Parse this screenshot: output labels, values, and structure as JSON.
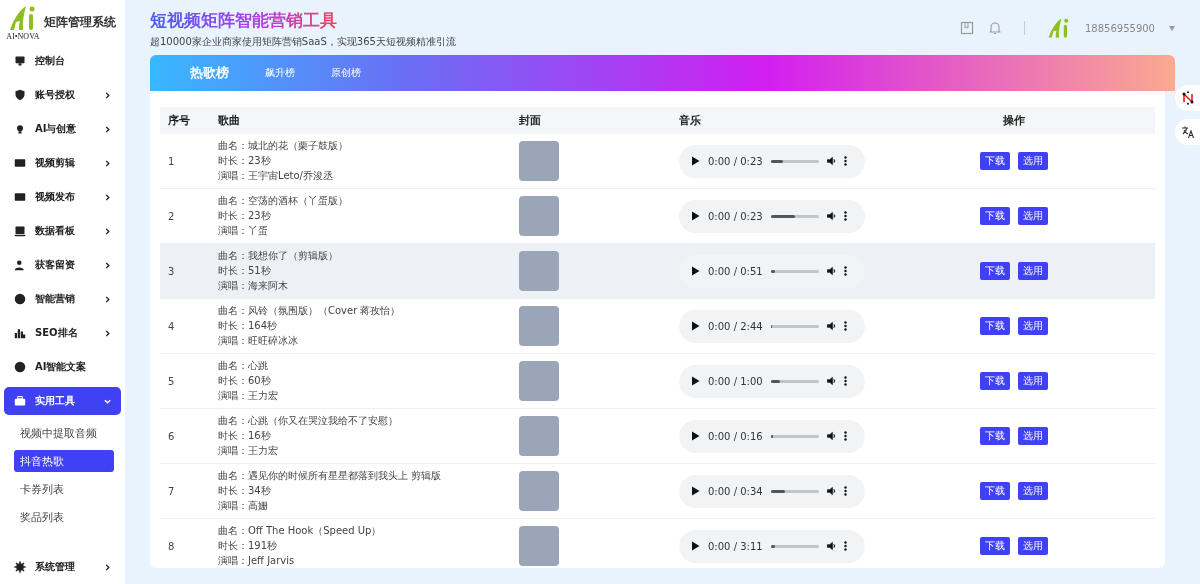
{
  "sidebar": {
    "logo_text": "AI•NOVA",
    "title": "矩阵管理系统",
    "items": [
      {
        "label": "控制台",
        "has_submenu": false,
        "expanded": false
      },
      {
        "label": "账号授权",
        "has_submenu": true,
        "expanded": false
      },
      {
        "label": "AI与创意",
        "has_submenu": true,
        "expanded": false
      },
      {
        "label": "视频剪辑",
        "has_submenu": true,
        "expanded": false
      },
      {
        "label": "视频发布",
        "has_submenu": true,
        "expanded": false
      },
      {
        "label": "数据看板",
        "has_submenu": true,
        "expanded": false
      },
      {
        "label": "获客留资",
        "has_submenu": true,
        "expanded": false
      },
      {
        "label": "智能营销",
        "has_submenu": true,
        "expanded": false
      },
      {
        "label": "SEO排名",
        "has_submenu": true,
        "expanded": false
      },
      {
        "label": "AI智能文案",
        "has_submenu": false,
        "expanded": false
      },
      {
        "label": "实用工具",
        "has_submenu": true,
        "expanded": true,
        "children": [
          {
            "label": "视频中提取音频",
            "selected": false
          },
          {
            "label": "抖音热歌",
            "selected": true
          },
          {
            "label": "卡券列表",
            "selected": false
          },
          {
            "label": "奖品列表",
            "selected": false
          }
        ]
      },
      {
        "label": "系统管理",
        "has_submenu": true,
        "expanded": false
      }
    ]
  },
  "header": {
    "title": "短视频矩阵智能营销工具",
    "subtitle": "超10000家企业商家使用矩阵营销SaaS，实现365天短视频精准引流",
    "account": "18856955900"
  },
  "tabs": [
    {
      "label": "热歌榜",
      "selected": true
    },
    {
      "label": "飙升榜",
      "selected": false
    },
    {
      "label": "原创榜",
      "selected": false
    }
  ],
  "table": {
    "columns": [
      "序号",
      "歌曲",
      "封面",
      "音乐",
      "操作"
    ],
    "rows": [
      {
        "index": "1",
        "title": "曲名：城北的花（栗子鼓版）",
        "duration": "时长：23秒",
        "singer": "演唱：王宇宙Leto/乔浚丞",
        "time": "0:00 / 0:23",
        "level": 0.25,
        "highlighted": false,
        "actions": [
          "下载",
          "选用"
        ]
      },
      {
        "index": "2",
        "title": "曲名：空荡的酒杯（丫蛋版）",
        "duration": "时长：23秒",
        "singer": "演唱：丫蛋",
        "time": "0:00 / 0:23",
        "level": 0.5,
        "highlighted": false,
        "actions": [
          "下载",
          "选用"
        ]
      },
      {
        "index": "3",
        "title": "曲名：我想你了（剪辑版）",
        "duration": "时长：51秒",
        "singer": "演唱：海来阿木",
        "time": "0:00 / 0:51",
        "level": 0.1,
        "highlighted": true,
        "actions": [
          "下载",
          "选用"
        ]
      },
      {
        "index": "4",
        "title": "曲名：风铃（氛围版）（Cover 蒋孜怡）",
        "duration": "时长：164秒",
        "singer": "演唱：旺旺碎冰冰",
        "time": "0:00 / 2:44",
        "level": 0.02,
        "highlighted": false,
        "actions": [
          "下载",
          "选用"
        ]
      },
      {
        "index": "5",
        "title": "曲名：心跳",
        "duration": "时长：60秒",
        "singer": "演唱：王力宏",
        "time": "0:00 / 1:00",
        "level": 0.2,
        "highlighted": false,
        "actions": [
          "下载",
          "选用"
        ]
      },
      {
        "index": "6",
        "title": "曲名：心跳（你又在哭泣我给不了安慰）",
        "duration": "时长：16秒",
        "singer": "演唱：王力宏",
        "time": "0:00 / 0:16",
        "level": 0.05,
        "highlighted": false,
        "actions": [
          "下载",
          "选用"
        ]
      },
      {
        "index": "7",
        "title": "曲名：遇见你的时候所有星星都落到我头上 剪辑版",
        "duration": "时长：34秒",
        "singer": "演唱：高姗",
        "time": "0:00 / 0:34",
        "level": 0.3,
        "highlighted": false,
        "actions": [
          "下载",
          "选用"
        ]
      },
      {
        "index": "8",
        "title": "曲名：Off The Hook（Speed Up）",
        "duration": "时长：191秒",
        "singer": "演唱：Jeff Jarvis",
        "time": "0:00 / 3:11",
        "level": 0.1,
        "highlighted": false,
        "actions": [
          "下载",
          "选用"
        ]
      }
    ]
  }
}
